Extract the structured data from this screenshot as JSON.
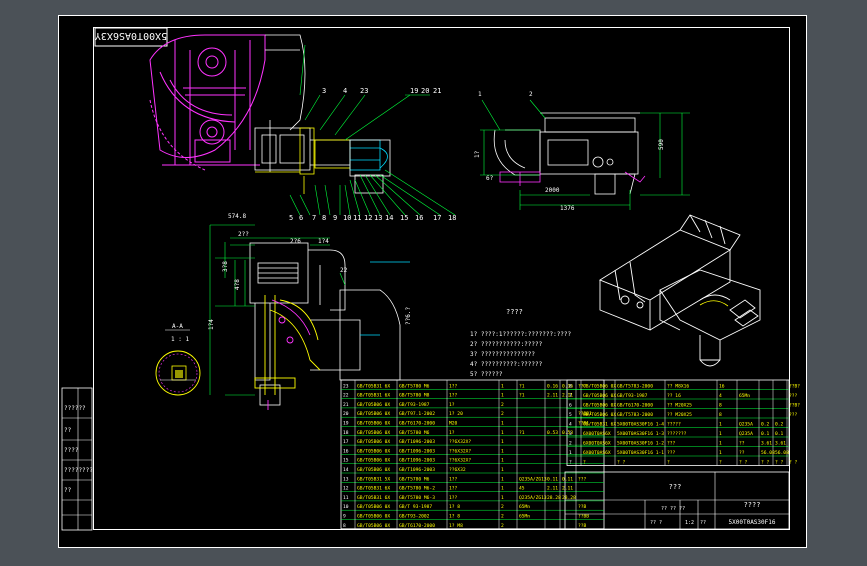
{
  "drawing": {
    "code_box": "5X00T0AS6X3Y",
    "callouts_top": [
      "1",
      "2",
      "3",
      "4",
      "23",
      "19",
      "20",
      "21"
    ],
    "callouts_bottom": [
      "5",
      "6",
      "7",
      "8",
      "9",
      "10",
      "11",
      "12",
      "13",
      "14",
      "15",
      "16",
      "17",
      "18"
    ],
    "section_label": "A-A",
    "scale_label": "1 : 1",
    "notes": [
      "1? ????:1??????:???????:????",
      "2? ???????????:?????",
      "3? ???????????????",
      "4? ??????????:??????",
      "5? ??????"
    ],
    "notes_title": "????",
    "dim_top_right": [
      "1376",
      "2000",
      "6?",
      "590",
      "1?"
    ],
    "dim_left": [
      "574.8",
      "2??",
      "3?8",
      "4?8",
      "1?4",
      "2?6",
      "1?4"
    ],
    "dim_bottom_right": "??6.?",
    "side_callout": "22",
    "colors": {
      "bg": "#000000",
      "frame": "#ffffff",
      "green": "#00ff3c",
      "magenta": "#ff33ff",
      "cyan": "#00dcff",
      "yellow": "#ffff00",
      "white": "#ffffff",
      "red": "#ff3333"
    }
  },
  "left_table_rows": [
    [
      "23",
      "GB/T05B31 6X",
      "GB/T5780 M6",
      "1??",
      "1",
      "?1",
      "0.16",
      "0.16",
      "???"
    ],
    [
      "22",
      "GB/T05B31 6X",
      "GB/T5780 M8",
      "1??",
      "1",
      "?1",
      "2.11",
      "2.11",
      ""
    ],
    [
      "21",
      "GB/T05B06 0X",
      "GB/T93-1987",
      "1?",
      "2",
      "",
      "",
      "",
      ""
    ],
    [
      "20",
      "GB/T05B06 0X",
      "GB/T97.1-2002",
      "1? 20",
      "2",
      "",
      "",
      "",
      "??BB1"
    ],
    [
      "19",
      "GB/T05B06 0X",
      "GB/T6170-2000",
      "M20",
      "1",
      "",
      "",
      "",
      "??B1"
    ],
    [
      "18",
      "GB/T05B06 0X",
      "GB/T5780 M6",
      "1?",
      "1",
      "?1",
      "0.53",
      "0.53",
      ""
    ],
    [
      "17",
      "GB/T05B06 0X",
      "GB/T1096-2003",
      "??6X32X?",
      "1",
      "",
      "",
      "",
      ""
    ],
    [
      "16",
      "GB/T05B06 0X",
      "GB/T1096-2003",
      "??6X32X?",
      "1",
      "",
      "",
      "",
      ""
    ],
    [
      "15",
      "GB/T05B06 0X",
      "GB/T1096-2003",
      "??6X32X?",
      "1",
      "",
      "",
      "",
      ""
    ],
    [
      "14",
      "GB/T05B06 0X",
      "GB/T1096-2003",
      "??6X32",
      "1",
      "",
      "",
      "",
      ""
    ],
    [
      "13",
      "GB/T05B31 5X",
      "GB/T5780 M6",
      "1??",
      "1",
      "Q235A/ZG13",
      "0.11",
      "0.11",
      "???"
    ],
    [
      "12",
      "GB/T05B31 6X",
      "GB/T5780 M6-2",
      "1??",
      "1",
      "45",
      "2.11",
      "2.11",
      ""
    ],
    [
      "11",
      "GB/T05B31 6X",
      "GB/T5780 M6-3",
      "1??",
      "1",
      "Q235A/ZG13",
      "28.28",
      "28.28",
      ""
    ],
    [
      "10",
      "GB/T05B06 0X",
      "GB/T 93-1987",
      "1? 8",
      "2",
      "65Mn",
      "",
      "",
      "??B"
    ],
    [
      "9",
      "GB/T05B06 0X",
      "GB/T93-2002",
      "1? 8",
      "2",
      "65Mn",
      "",
      "",
      "??BB"
    ],
    [
      "8",
      "GB/T05B06 0X",
      "GB/T6170-2000",
      "1? M8",
      "2",
      "",
      "",
      "",
      "??B"
    ]
  ],
  "right_table_rows": [
    [
      "8",
      "GB/T05B06 0X",
      "GB/T5783-2000",
      "?? M8X16",
      "16",
      "",
      "",
      "",
      "??B?"
    ],
    [
      "7",
      "GB/T05B06 0X",
      "GB/T93-1987",
      "?? 16",
      "4",
      "65Mn",
      "",
      "",
      "???"
    ],
    [
      "6",
      "GB/T05B06 0X",
      "GB/T6170-2000",
      "?? M20X25",
      "8",
      "",
      "",
      "",
      "??B?"
    ],
    [
      "5",
      "GB/T05B06 0X",
      "GB/T5783-2000",
      "?? M20X25",
      "8",
      "",
      "",
      "",
      "???"
    ],
    [
      "4",
      "GB/T05B31 6X",
      "5X00T0AS30F16 1-4",
      "?????",
      "1",
      "Q235A",
      "0.2",
      "0.2",
      ""
    ],
    [
      "3",
      "6X00T0AS6X",
      "5X00T0AS30F16 1-3",
      "???????",
      "1",
      "Q235A",
      "0.1",
      "0.1",
      ""
    ],
    [
      "2",
      "6X00T0AS6X",
      "5X00T0AS30F16 1-2",
      "???",
      "1",
      "??",
      "3.61",
      "3.61",
      ""
    ],
    [
      "1",
      "6X00T0AS6X",
      "5X00T0AS30F16 1-1",
      "???",
      "1",
      "??",
      "56.08",
      "56.08",
      ""
    ]
  ],
  "right_table_header": [
    "?",
    "?",
    "?  ?",
    "?",
    "?",
    "?  ?",
    "?  ?",
    "?  ?",
    "?  ?"
  ],
  "title_block": {
    "title_a": "???",
    "title_b": "????",
    "drawing_no": "5X00T0AS30F16",
    "scale": "1:2",
    "weight": "??",
    "sheet": "?? ?",
    "note_row": "?? ?? ??"
  },
  "left_margin_labels": [
    "??????",
    "??",
    "????",
    "????????",
    "??",
    "??",
    "????",
    "????"
  ]
}
